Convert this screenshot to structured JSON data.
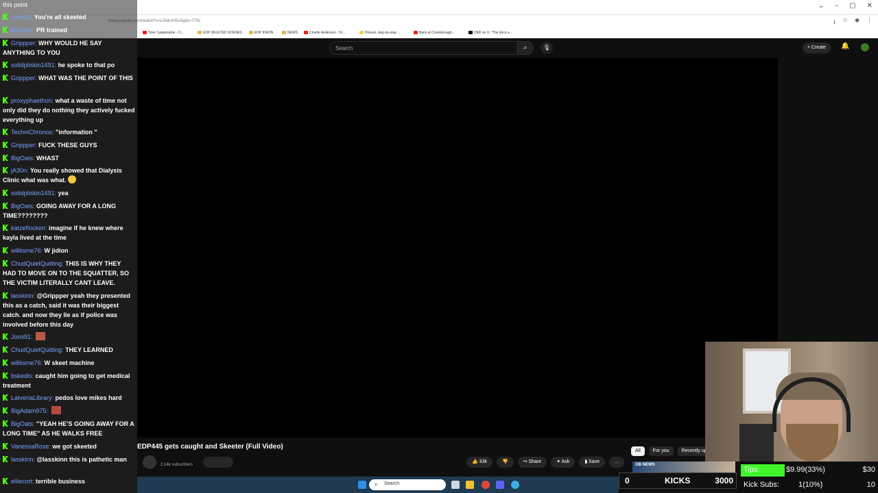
{
  "browser": {
    "url": "www.youtube.com/watch?v=L5NkXPEn5g&t=779s",
    "bookmarks": [
      "Tyler Catastrophe - O...",
      "EDP DELETED SCENES",
      "EDP IDEON",
      "NEWS",
      "Charlie Anderson - Yo...",
      "Honest, step-by-step ...",
      "Back at Crowborough...",
      "DM2 on X: \"The docs a..."
    ]
  },
  "youtube": {
    "search_placeholder": "Search",
    "create_label": "Create",
    "video_title": "EDP445 gets caught and Skeeter (Full Video)",
    "subscribers": "2.14k subscribers",
    "actions": {
      "like_count": "33k",
      "share": "Share",
      "ask": "Ask",
      "save": "Save",
      "more": "..."
    },
    "chips": [
      "All",
      "For you",
      "Recently up"
    ]
  },
  "chat": {
    "header": "this point",
    "messages": [
      {
        "user": "Jomi91",
        "text": "You're all skeeted"
      },
      {
        "user": "BigOats",
        "text": "PR trained"
      },
      {
        "user": "Grippper",
        "text": "WHY WOULD HE SAY ANYTHING TO YOU"
      },
      {
        "user": "solidpliskin1491",
        "text": "he spoke to that po"
      },
      {
        "user": "Grippper",
        "text": "WHAT WAS THE POINT OF THIS"
      },
      {
        "user": "proxyphaethon",
        "text": "what a waste of time not only did they do nothing they actively fucked everything up"
      },
      {
        "user": "TechniChronos",
        "text": "\"information \""
      },
      {
        "user": "Grippper",
        "text": "FUCK THESE GUYS"
      },
      {
        "user": "BigOats",
        "text": "WHAST"
      },
      {
        "user": "jA30n",
        "text": "You really showed that Dialysis Clinic what was what."
      },
      {
        "user": "solidpliskin1491",
        "text": "yea"
      },
      {
        "user": "BigOats",
        "text": "GOING AWAY FOR A LONG TIME????????"
      },
      {
        "user": "katzeflocken",
        "text": "imagine if he knew where kayla lived at the time"
      },
      {
        "user": "williisme76",
        "text": "W jidion"
      },
      {
        "user": "ChudQuietQuitting",
        "text": "THIS IS WHY THEY HAD TO MOVE ON TO THE SQUATTER, SO THE VICTIM LITERALLY CANT LEAVE."
      },
      {
        "user": "lasskinn",
        "text": "@Grippper yeah they presented this as a catch, said it was their biggest catch. and now they lie as if police was involved before this day"
      },
      {
        "user": "Jomi91",
        "text": ""
      },
      {
        "user": "ChudQuietQuitting",
        "text": "THEY LEARNED"
      },
      {
        "user": "williisme76",
        "text": "W skeet machine"
      },
      {
        "user": "bskedis",
        "text": "caught him going to get medical treatment"
      },
      {
        "user": "LatveriaLibrary",
        "text": "pedos love mikes hard"
      },
      {
        "user": "BigAdam975",
        "text": ""
      },
      {
        "user": "BigOats",
        "text": "\"YEAH HE'S GOING AWAY FOR A LONG TIME\" AS HE WALKS FREE"
      },
      {
        "user": "VanessaRose",
        "text": "we got skeeted"
      },
      {
        "user": "lasskinn",
        "text": "@lasskinn this is pathetic man"
      },
      {
        "user": "elliecort",
        "text": "terrible business"
      }
    ]
  },
  "overlay": {
    "news_logo": "GB NEWS",
    "kicks": {
      "left": "0",
      "label": "KICKS",
      "right": "3000"
    },
    "tips": {
      "label": "Tips:",
      "value": "$9.99(33%)",
      "amount": "$30"
    },
    "kick_subs": {
      "label": "Kick Subs:",
      "value": "1(10%)",
      "amount": "10"
    }
  },
  "taskbar": {
    "search_label": "Search"
  },
  "colors": {
    "kick_green": "#53fc18",
    "username_blue": "#7aa2ff",
    "tip_bar": "#3ef52a"
  }
}
